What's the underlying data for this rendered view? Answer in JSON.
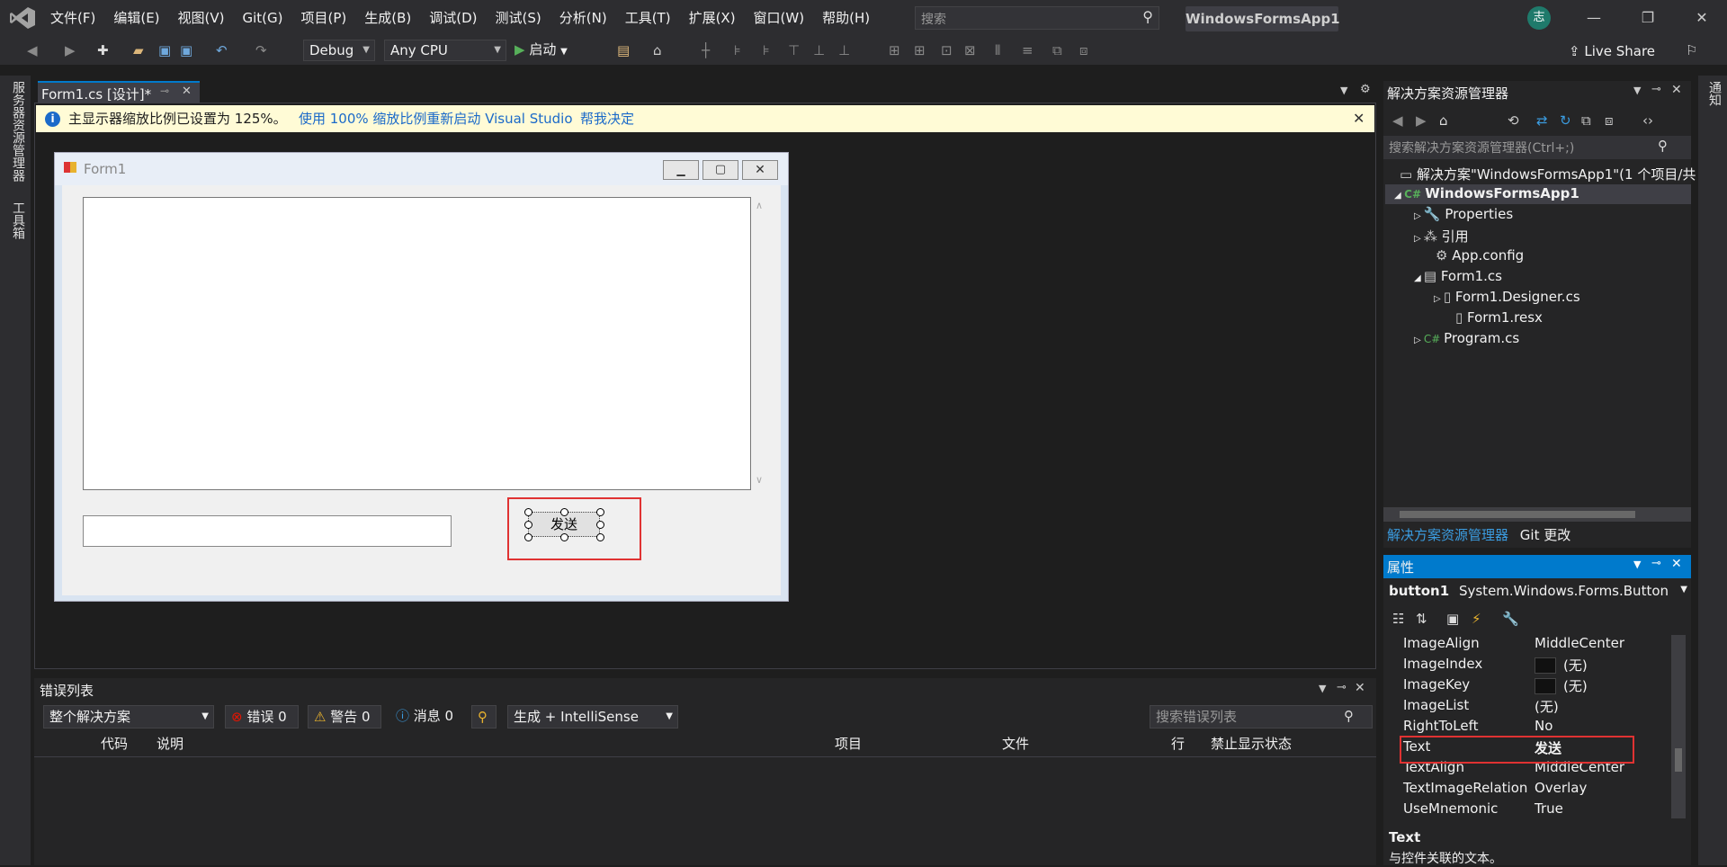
{
  "menubar": {
    "items": [
      "文件(F)",
      "编辑(E)",
      "视图(V)",
      "Git(G)",
      "项目(P)",
      "生成(B)",
      "调试(D)",
      "测试(S)",
      "分析(N)",
      "工具(T)",
      "扩展(X)",
      "窗口(W)",
      "帮助(H)"
    ],
    "search_placeholder": "搜索",
    "app_title": "WindowsFormsApp1",
    "avatar_initial": "志"
  },
  "toolbar": {
    "config": "Debug",
    "platform": "Any CPU",
    "start_label": "启动",
    "live_share": "Live Share"
  },
  "left_strip": {
    "tab1": "服务器资源管理器",
    "tab2": "工具箱"
  },
  "right_strip": {
    "tab1": "通知"
  },
  "document": {
    "tab_title": "Form1.cs [设计]*",
    "info_message": "主显示器缩放比例已设置为 125%。",
    "info_link1": "使用 100% 缩放比例重新启动 Visual Studio",
    "info_link2": "帮我决定"
  },
  "form_designer": {
    "form_title": "Form1",
    "button_text": "发送"
  },
  "solution_explorer": {
    "title": "解决方案资源管理器",
    "search_placeholder": "搜索解决方案资源管理器(Ctrl+;)",
    "solution": "解决方案\"WindowsFormsApp1\"(1 个项目/共",
    "project": "WindowsFormsApp1",
    "items": [
      "Properties",
      "引用",
      "App.config",
      "Form1.cs",
      "Form1.Designer.cs",
      "Form1.resx",
      "Program.cs"
    ],
    "tab_active": "解决方案资源管理器",
    "tab_git": "Git 更改"
  },
  "properties": {
    "title": "属性",
    "object_name": "button1",
    "object_type": "System.Windows.Forms.Button",
    "rows": [
      {
        "name": "ImageAlign",
        "value": "MiddleCenter"
      },
      {
        "name": "ImageIndex",
        "value": "(无)"
      },
      {
        "name": "ImageKey",
        "value": "(无)"
      },
      {
        "name": "ImageList",
        "value": "(无)"
      },
      {
        "name": "RightToLeft",
        "value": "No"
      },
      {
        "name": "Text",
        "value": "发送"
      },
      {
        "name": "TextAlign",
        "value": "MiddleCenter"
      },
      {
        "name": "TextImageRelation",
        "value": "Overlay"
      },
      {
        "name": "UseMnemonic",
        "value": "True"
      }
    ],
    "desc_title": "Text",
    "desc_text": "与控件关联的文本。"
  },
  "error_list": {
    "title": "错误列表",
    "scope": "整个解决方案",
    "errors": "错误 0",
    "warnings": "警告 0",
    "messages": "消息 0",
    "build_filter": "生成 + IntelliSense",
    "search_placeholder": "搜索错误列表",
    "columns": [
      "代码",
      "说明",
      "项目",
      "文件",
      "行",
      "禁止显示状态"
    ]
  },
  "colors": {
    "accent": "#007acc",
    "highlight": "#e03232",
    "infobar": "#fffbd6"
  }
}
